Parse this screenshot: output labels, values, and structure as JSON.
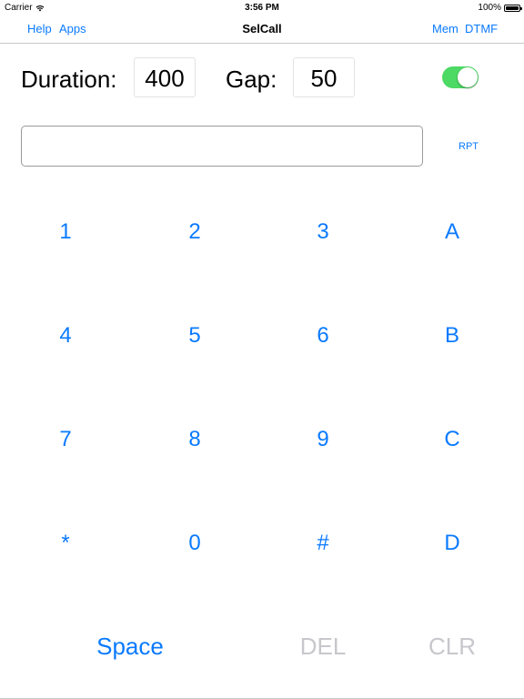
{
  "status_bar": {
    "carrier": "Carrier",
    "time": "3:56 PM",
    "battery": "100%"
  },
  "nav": {
    "title": "SelCall",
    "left_items": [
      "Help",
      "Apps"
    ],
    "right_items": [
      "Mem",
      "DTMF"
    ]
  },
  "params": {
    "duration_label": "Duration:",
    "duration_value": "400",
    "gap_label": "Gap:",
    "gap_value": "50",
    "toggle_on": true
  },
  "code_field": {
    "value": ""
  },
  "rpt_label": "RPT",
  "keypad": {
    "rows": [
      [
        "1",
        "2",
        "3",
        "A"
      ],
      [
        "4",
        "5",
        "6",
        "B"
      ],
      [
        "7",
        "8",
        "9",
        "C"
      ],
      [
        "*",
        "0",
        "#",
        "D"
      ]
    ]
  },
  "bottom_keys": {
    "space": "Space",
    "del": "DEL",
    "clr": "CLR"
  },
  "colors": {
    "accent": "#0a7aff",
    "toggle_on": "#4cd964",
    "disabled": "#c7c7cc"
  }
}
